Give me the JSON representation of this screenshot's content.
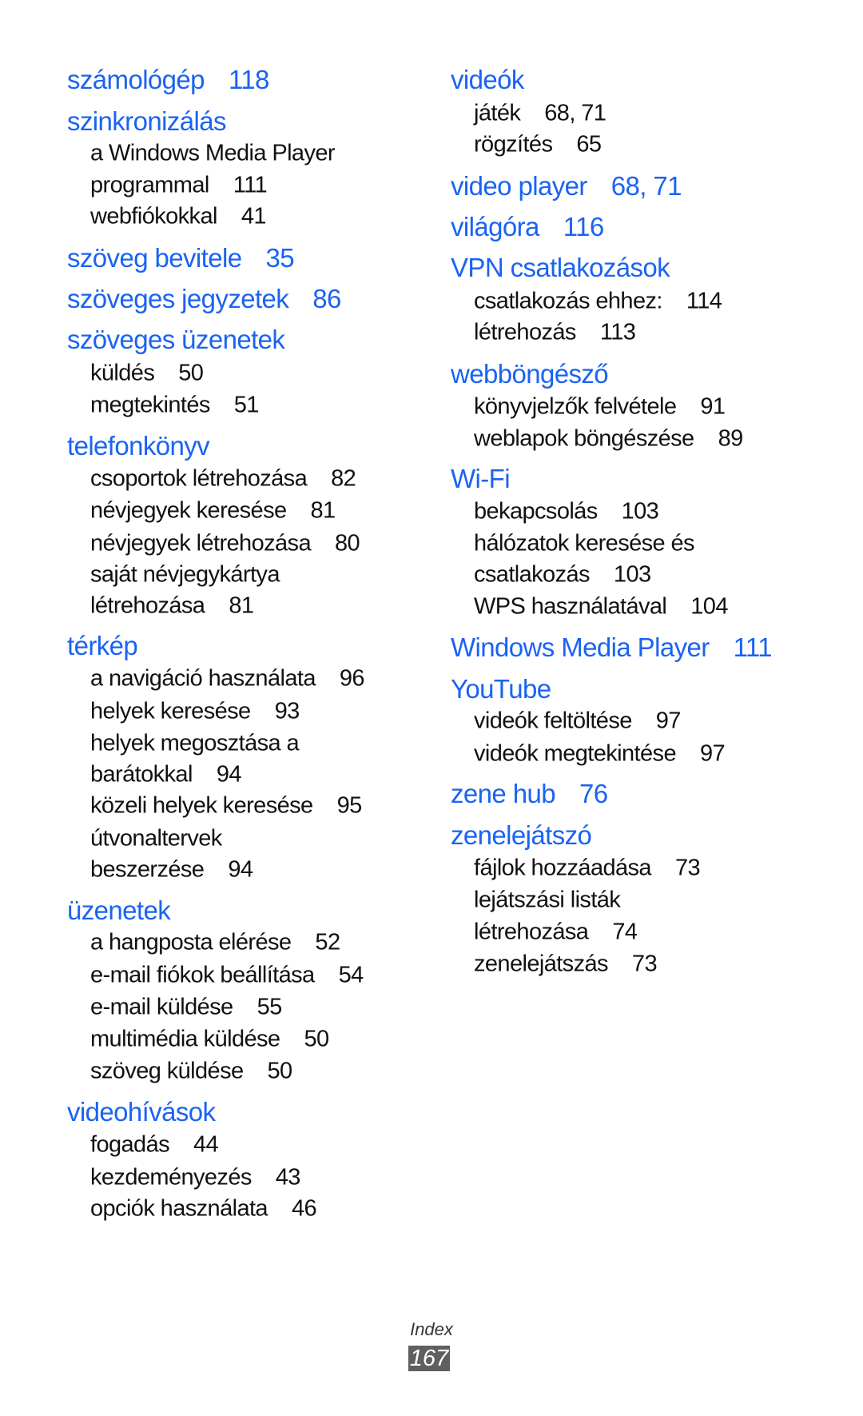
{
  "colors": {
    "heading": "#1a63f2",
    "subentry": "#111111",
    "page_badge_bg": "#5f5f5f"
  },
  "left_column": [
    {
      "type": "head",
      "text": "számológép",
      "pages": "118"
    },
    {
      "type": "head",
      "text": "szinkronizálás",
      "pages": ""
    },
    {
      "type": "sub",
      "text": "a Windows Media Player",
      "pages": ""
    },
    {
      "type": "sub",
      "text": "programmal",
      "pages": "111"
    },
    {
      "type": "sub",
      "text": "webfiókokkal",
      "pages": "41"
    },
    {
      "type": "head",
      "text": "szöveg bevitele",
      "pages": "35"
    },
    {
      "type": "head",
      "text": "szöveges jegyzetek",
      "pages": "86"
    },
    {
      "type": "head",
      "text": "szöveges üzenetek",
      "pages": ""
    },
    {
      "type": "sub",
      "text": "küldés",
      "pages": "50"
    },
    {
      "type": "sub",
      "text": "megtekintés",
      "pages": "51"
    },
    {
      "type": "head",
      "text": "telefonkönyv",
      "pages": ""
    },
    {
      "type": "sub",
      "text": "csoportok létrehozása",
      "pages": "82"
    },
    {
      "type": "sub",
      "text": "névjegyek keresése",
      "pages": "81"
    },
    {
      "type": "sub",
      "text": "névjegyek létrehozása",
      "pages": "80"
    },
    {
      "type": "sub",
      "text": "saját névjegykártya",
      "pages": ""
    },
    {
      "type": "sub",
      "text": "létrehozása",
      "pages": "81"
    },
    {
      "type": "head",
      "text": "térkép",
      "pages": ""
    },
    {
      "type": "sub",
      "text": "a navigáció használata",
      "pages": "96"
    },
    {
      "type": "sub",
      "text": "helyek keresése",
      "pages": "93"
    },
    {
      "type": "sub",
      "text": "helyek megosztása a",
      "pages": ""
    },
    {
      "type": "sub",
      "text": "barátokkal",
      "pages": "94"
    },
    {
      "type": "sub",
      "text": "közeli helyek keresése",
      "pages": "95"
    },
    {
      "type": "sub",
      "text": "útvonaltervek",
      "pages": ""
    },
    {
      "type": "sub",
      "text": "beszerzése",
      "pages": "94"
    },
    {
      "type": "head",
      "text": "üzenetek",
      "pages": ""
    },
    {
      "type": "sub",
      "text": "a hangposta elérése",
      "pages": "52"
    },
    {
      "type": "sub",
      "text": "e-mail fiókok beállítása",
      "pages": "54"
    },
    {
      "type": "sub",
      "text": "e-mail küldése",
      "pages": "55"
    },
    {
      "type": "sub",
      "text": "multimédia küldése",
      "pages": "50"
    },
    {
      "type": "sub",
      "text": "szöveg küldése",
      "pages": "50"
    },
    {
      "type": "head",
      "text": "videohívások",
      "pages": ""
    },
    {
      "type": "sub",
      "text": "fogadás",
      "pages": "44"
    },
    {
      "type": "sub",
      "text": "kezdeményezés",
      "pages": "43"
    },
    {
      "type": "sub",
      "text": "opciók használata",
      "pages": "46"
    }
  ],
  "right_column": [
    {
      "type": "head",
      "text": "videók",
      "pages": ""
    },
    {
      "type": "sub",
      "text": "játék",
      "pages": "68, 71"
    },
    {
      "type": "sub",
      "text": "rögzítés",
      "pages": "65"
    },
    {
      "type": "head",
      "text": "video player",
      "pages": "68, 71"
    },
    {
      "type": "head",
      "text": "világóra",
      "pages": "116"
    },
    {
      "type": "head",
      "text": "VPN csatlakozások",
      "pages": ""
    },
    {
      "type": "sub",
      "text": "csatlakozás ehhez:",
      "pages": "114"
    },
    {
      "type": "sub",
      "text": "létrehozás",
      "pages": "113"
    },
    {
      "type": "head",
      "text": "webböngésző",
      "pages": ""
    },
    {
      "type": "sub",
      "text": "könyvjelzők felvétele",
      "pages": "91"
    },
    {
      "type": "sub",
      "text": "weblapok böngészése",
      "pages": "89"
    },
    {
      "type": "head",
      "text": "Wi-Fi",
      "pages": ""
    },
    {
      "type": "sub",
      "text": "bekapcsolás",
      "pages": "103"
    },
    {
      "type": "sub",
      "text": "hálózatok keresése és",
      "pages": ""
    },
    {
      "type": "sub",
      "text": "csatlakozás",
      "pages": "103"
    },
    {
      "type": "sub",
      "text": "WPS használatával",
      "pages": "104"
    },
    {
      "type": "head",
      "text": "Windows Media Player",
      "pages": "111"
    },
    {
      "type": "head",
      "text": "YouTube",
      "pages": ""
    },
    {
      "type": "sub",
      "text": "videók feltöltése",
      "pages": "97"
    },
    {
      "type": "sub",
      "text": "videók megtekintése",
      "pages": "97"
    },
    {
      "type": "head",
      "text": "zene hub",
      "pages": "76"
    },
    {
      "type": "head",
      "text": "zenelejátszó",
      "pages": ""
    },
    {
      "type": "sub",
      "text": "fájlok hozzáadása",
      "pages": "73"
    },
    {
      "type": "sub",
      "text": "lejátszási listák",
      "pages": ""
    },
    {
      "type": "sub",
      "text": "létrehozása",
      "pages": "74"
    },
    {
      "type": "sub",
      "text": "zenelejátszás",
      "pages": "73"
    }
  ],
  "footer": {
    "section_label": "Index",
    "page_number": "167"
  }
}
